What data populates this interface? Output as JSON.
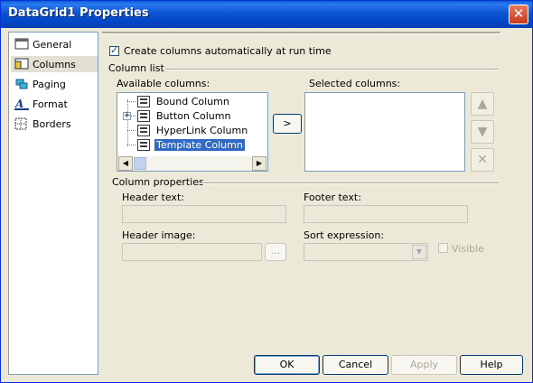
{
  "window": {
    "title": "DataGrid1 Properties",
    "close_glyph": "✕"
  },
  "nav": {
    "items": [
      {
        "label": "General",
        "icon": "general-icon"
      },
      {
        "label": "Columns",
        "icon": "columns-icon"
      },
      {
        "label": "Paging",
        "icon": "paging-icon"
      },
      {
        "label": "Format",
        "icon": "format-icon"
      },
      {
        "label": "Borders",
        "icon": "borders-icon"
      }
    ],
    "selected": "Columns"
  },
  "columns": {
    "auto_create_label": "Create columns automatically at run time",
    "auto_create_checked": true,
    "column_list_label": "Column list",
    "available_label": "Available columns:",
    "available_items": [
      "Bound Column",
      "Button Column",
      "HyperLink Column",
      "Template Column"
    ],
    "available_selected": "Template Column",
    "add_button": ">",
    "selected_label": "Selected columns:",
    "move_up_glyph": "▲",
    "move_down_glyph": "▼",
    "delete_glyph": "✕"
  },
  "properties": {
    "group_label": "Column properties",
    "header_text_label": "Header text:",
    "header_text_value": "",
    "footer_text_label": "Footer text:",
    "footer_text_value": "",
    "header_image_label": "Header image:",
    "header_image_value": "",
    "browse_button": "...",
    "sort_expression_label": "Sort expression:",
    "sort_expression_value": "",
    "visible_label": "Visible",
    "visible_checked": false
  },
  "buttons": {
    "ok": "OK",
    "cancel": "Cancel",
    "apply": "Apply",
    "help": "Help"
  }
}
